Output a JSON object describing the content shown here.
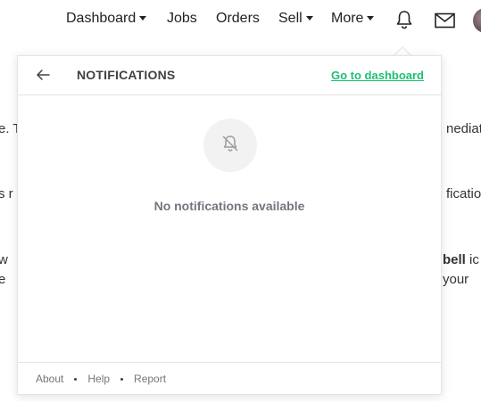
{
  "nav": {
    "dashboard": "Dashboard",
    "jobs": "Jobs",
    "orders": "Orders",
    "sell": "Sell",
    "more": "More"
  },
  "background_text": {
    "line1_left": "e. T",
    "line1_right": "nediate",
    "line2_left": "s r",
    "line2_right": "ficatio",
    "line3_left": "w",
    "line3_right_bold": "bell",
    "line3_right_tail": "ic",
    "line4_left": "e",
    "line4_right": "your"
  },
  "notifications": {
    "title": "NOTIFICATIONS",
    "dashboard_link": "Go to dashboard",
    "empty_message": "No notifications available",
    "footer": {
      "about": "About",
      "help": "Help",
      "report": "Report"
    }
  },
  "colors": {
    "accent": "#1dbf73",
    "muted": "#74767e",
    "title": "#404145"
  }
}
